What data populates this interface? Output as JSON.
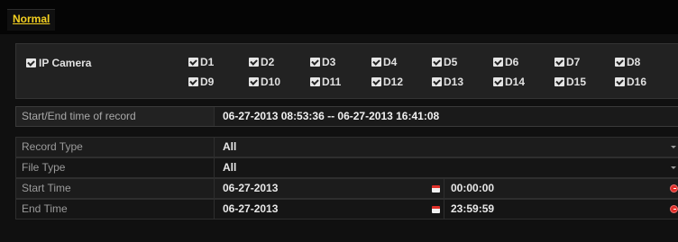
{
  "tabs": [
    {
      "label": "Normal"
    }
  ],
  "cameras": {
    "ip_camera_label": "IP Camera",
    "channels_row1": [
      "D1",
      "D2",
      "D3",
      "D4",
      "D5",
      "D6",
      "D7",
      "D8"
    ],
    "channels_row2": [
      "D9",
      "D10",
      "D11",
      "D12",
      "D13",
      "D14",
      "D15",
      "D16"
    ]
  },
  "record_range": {
    "label": "Start/End time of record",
    "value": "06-27-2013 08:53:36 -- 06-27-2013 16:41:08"
  },
  "record_type": {
    "label": "Record Type",
    "value": "All"
  },
  "file_type": {
    "label": "File Type",
    "value": "All"
  },
  "start_time": {
    "label": "Start Time",
    "date": "06-27-2013",
    "time": "00:00:00"
  },
  "end_time": {
    "label": "End Time",
    "date": "06-27-2013",
    "time": "23:59:59"
  },
  "colors": {
    "tab_accent": "#f4d020",
    "icon_red": "#e0302a"
  }
}
